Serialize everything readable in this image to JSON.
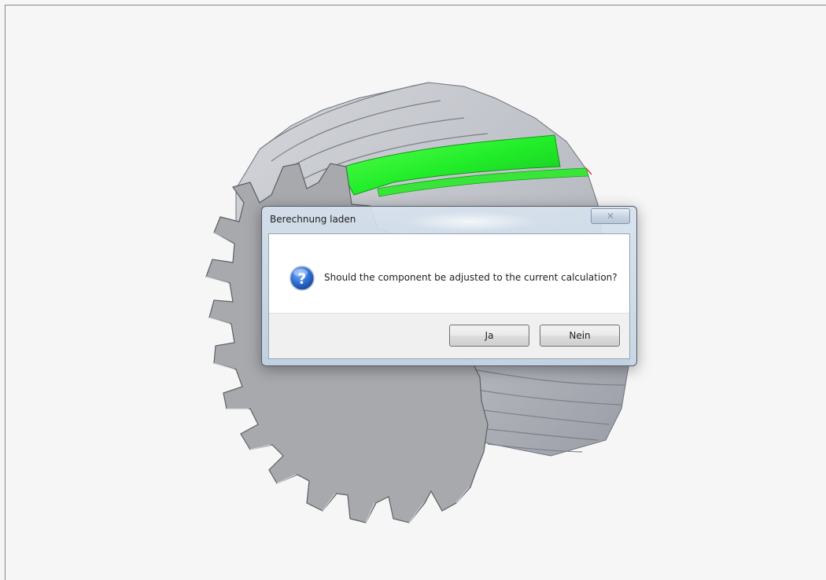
{
  "dialog": {
    "title": "Berechnung laden",
    "message": "Should the component be adjusted to the current calculation?",
    "icon": "question-icon",
    "buttons": {
      "yes_label": "Ja",
      "no_label": "Nein"
    },
    "close_icon": "close-icon"
  },
  "viewport": {
    "model": "helical-gear",
    "colors": {
      "gear_face": "#a7a9ad",
      "gear_flank": "#bfc2c8",
      "highlight": "#22ee33",
      "background": "#f6f6f6"
    }
  }
}
